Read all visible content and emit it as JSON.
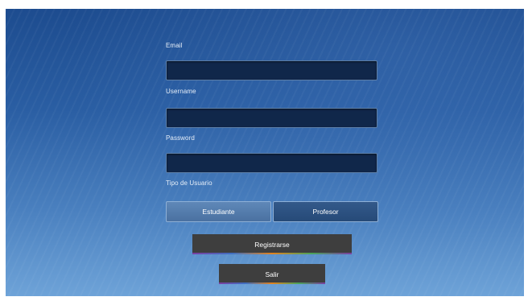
{
  "form": {
    "email_label": "Email",
    "email_value": "",
    "username_label": "Username",
    "username_value": "",
    "password_label": "Password",
    "password_value": "",
    "user_type_label": "Tipo de Usuario",
    "user_type_options": [
      "Estudiante",
      "Profesor"
    ],
    "user_type_selected": "Estudiante"
  },
  "actions": {
    "register_label": "Registrarse",
    "exit_label": "Salir"
  },
  "colors": {
    "background_top": "#1d4c8f",
    "background_bottom": "#6ea3d8",
    "field_fill": "#10274a",
    "button_fill": "#3e3e3e"
  }
}
